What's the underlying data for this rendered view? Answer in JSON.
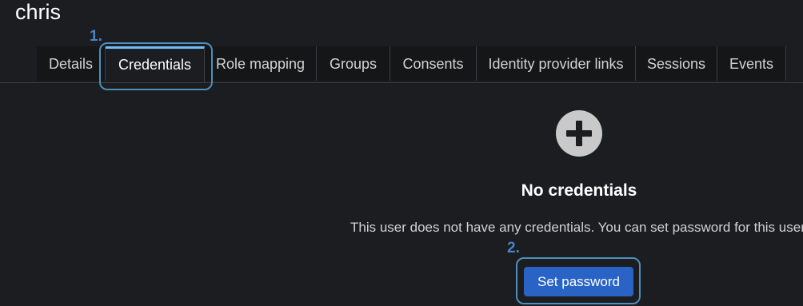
{
  "page": {
    "title": "chris"
  },
  "tabs": [
    {
      "label": "Details",
      "active": false
    },
    {
      "label": "Credentials",
      "active": true
    },
    {
      "label": "Role mapping",
      "active": false
    },
    {
      "label": "Groups",
      "active": false
    },
    {
      "label": "Consents",
      "active": false
    },
    {
      "label": "Identity provider links",
      "active": false
    },
    {
      "label": "Sessions",
      "active": false
    },
    {
      "label": "Events",
      "active": false
    }
  ],
  "empty_state": {
    "icon": "plus-circle-icon",
    "title": "No credentials",
    "body": "This user does not have any credentials. You can set password for this user.",
    "action_label": "Set password"
  },
  "annotations": {
    "step1": "1.",
    "step2": "2."
  },
  "colors": {
    "background": "#1b1d21",
    "tab_background": "#151617",
    "active_tab_indicator": "#73bcf7",
    "primary_button": "#2a63c6",
    "annotation_box": "#4d8fbd",
    "annotation_number": "#4a82c6",
    "icon_fill": "#c9c9c9"
  }
}
